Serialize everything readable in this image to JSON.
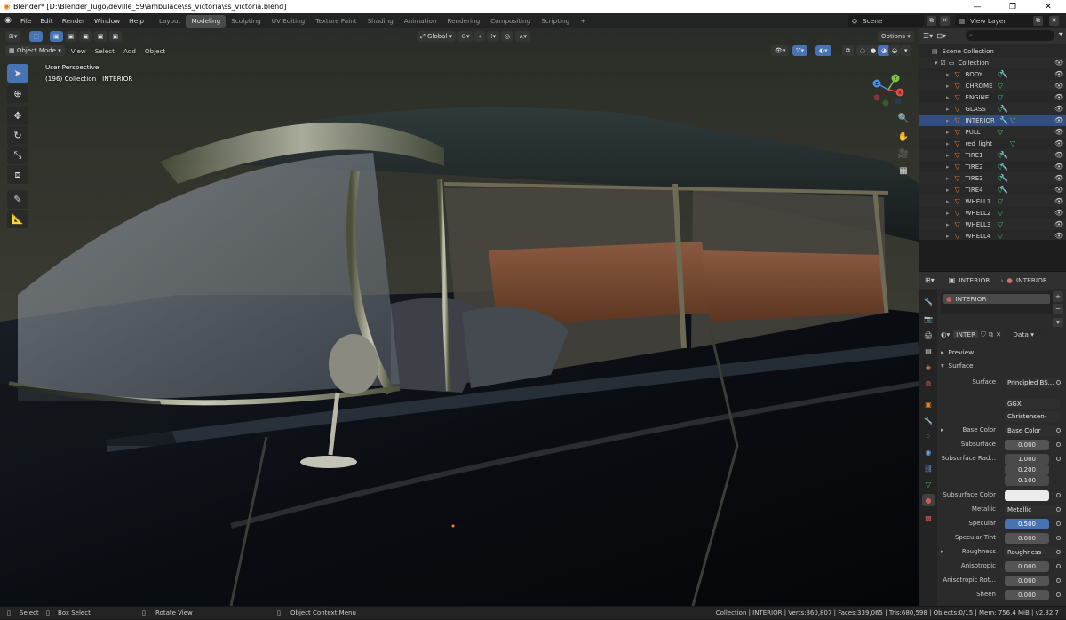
{
  "window": {
    "title": "Blender* [D:\\Blender_lugo\\deville_59\\ambulace\\ss_victoria\\ss_victoria.blend]"
  },
  "menu": [
    "File",
    "Edit",
    "Render",
    "Window",
    "Help"
  ],
  "workspaces": [
    "Layout",
    "Modeling",
    "Sculpting",
    "UV Editing",
    "Texture Paint",
    "Shading",
    "Animation",
    "Rendering",
    "Compositing",
    "Scripting"
  ],
  "active_workspace": "Modeling",
  "scene": {
    "name": "Scene"
  },
  "view_layer": {
    "name": "View Layer"
  },
  "viewport": {
    "mode": "Object Mode",
    "menus": [
      "View",
      "Select",
      "Add",
      "Object"
    ],
    "orientation": "Global",
    "options_label": "Options",
    "info_line1": "User Perspective",
    "info_line2": "(196) Collection | INTERIOR",
    "gizmo_axes": [
      "X",
      "Y",
      "Z"
    ]
  },
  "outliner": {
    "root": "Scene Collection",
    "collection": "Collection",
    "objects": [
      "BODY",
      "CHROME",
      "ENGINE",
      "GLASS",
      "INTERIOR",
      "PULL",
      "red_light",
      "TIRE1",
      "TIRE2",
      "TIRE3",
      "TIRE4",
      "WHELL1",
      "WHELL2",
      "WHELL3",
      "WHELL4"
    ],
    "selected": "INTERIOR"
  },
  "properties": {
    "header_object": "INTERIOR",
    "header_material": "INTERIOR",
    "slot_name": "INTERIOR",
    "material_field": "INTER",
    "data_link": "Data",
    "panel_preview": "Preview",
    "panel_surface": "Surface",
    "surface_label": "Surface",
    "surface_value": "Principled BS...",
    "distribution": "GGX",
    "subsurface_method": "Christensen-Bu...",
    "fields": [
      {
        "label": "Base Color",
        "value": "Base Color"
      },
      {
        "label": "Subsurface",
        "value": "0.000"
      },
      {
        "label": "Subsurface Rad...",
        "value": "1.000"
      },
      {
        "label": "",
        "value": "0.200"
      },
      {
        "label": "",
        "value": "0.100"
      },
      {
        "label": "Subsurface Color",
        "value": ""
      },
      {
        "label": "Metallic",
        "value": "Metallic"
      },
      {
        "label": "Specular",
        "value": "0.500"
      },
      {
        "label": "Specular Tint",
        "value": "0.000"
      },
      {
        "label": "Roughness",
        "value": "Roughness"
      },
      {
        "label": "Anisotropic",
        "value": "0.000"
      },
      {
        "label": "Anisotropic Rot...",
        "value": "0.000"
      },
      {
        "label": "Sheen",
        "value": "0.000"
      }
    ]
  },
  "statusbar": {
    "select": "Select",
    "box_select": "Box Select",
    "rotate_view": "Rotate View",
    "context_menu": "Object Context Menu",
    "stats": "Collection | INTERIOR | Verts:360,807 | Faces:339,065 | Tris:680,598 | Objects:0/15 | Mem: 756.4 MiB | v2.82.7"
  },
  "colors": {
    "accent": "#4772b3",
    "object_orange": "#e8822a",
    "data_green": "#3cbf73"
  }
}
